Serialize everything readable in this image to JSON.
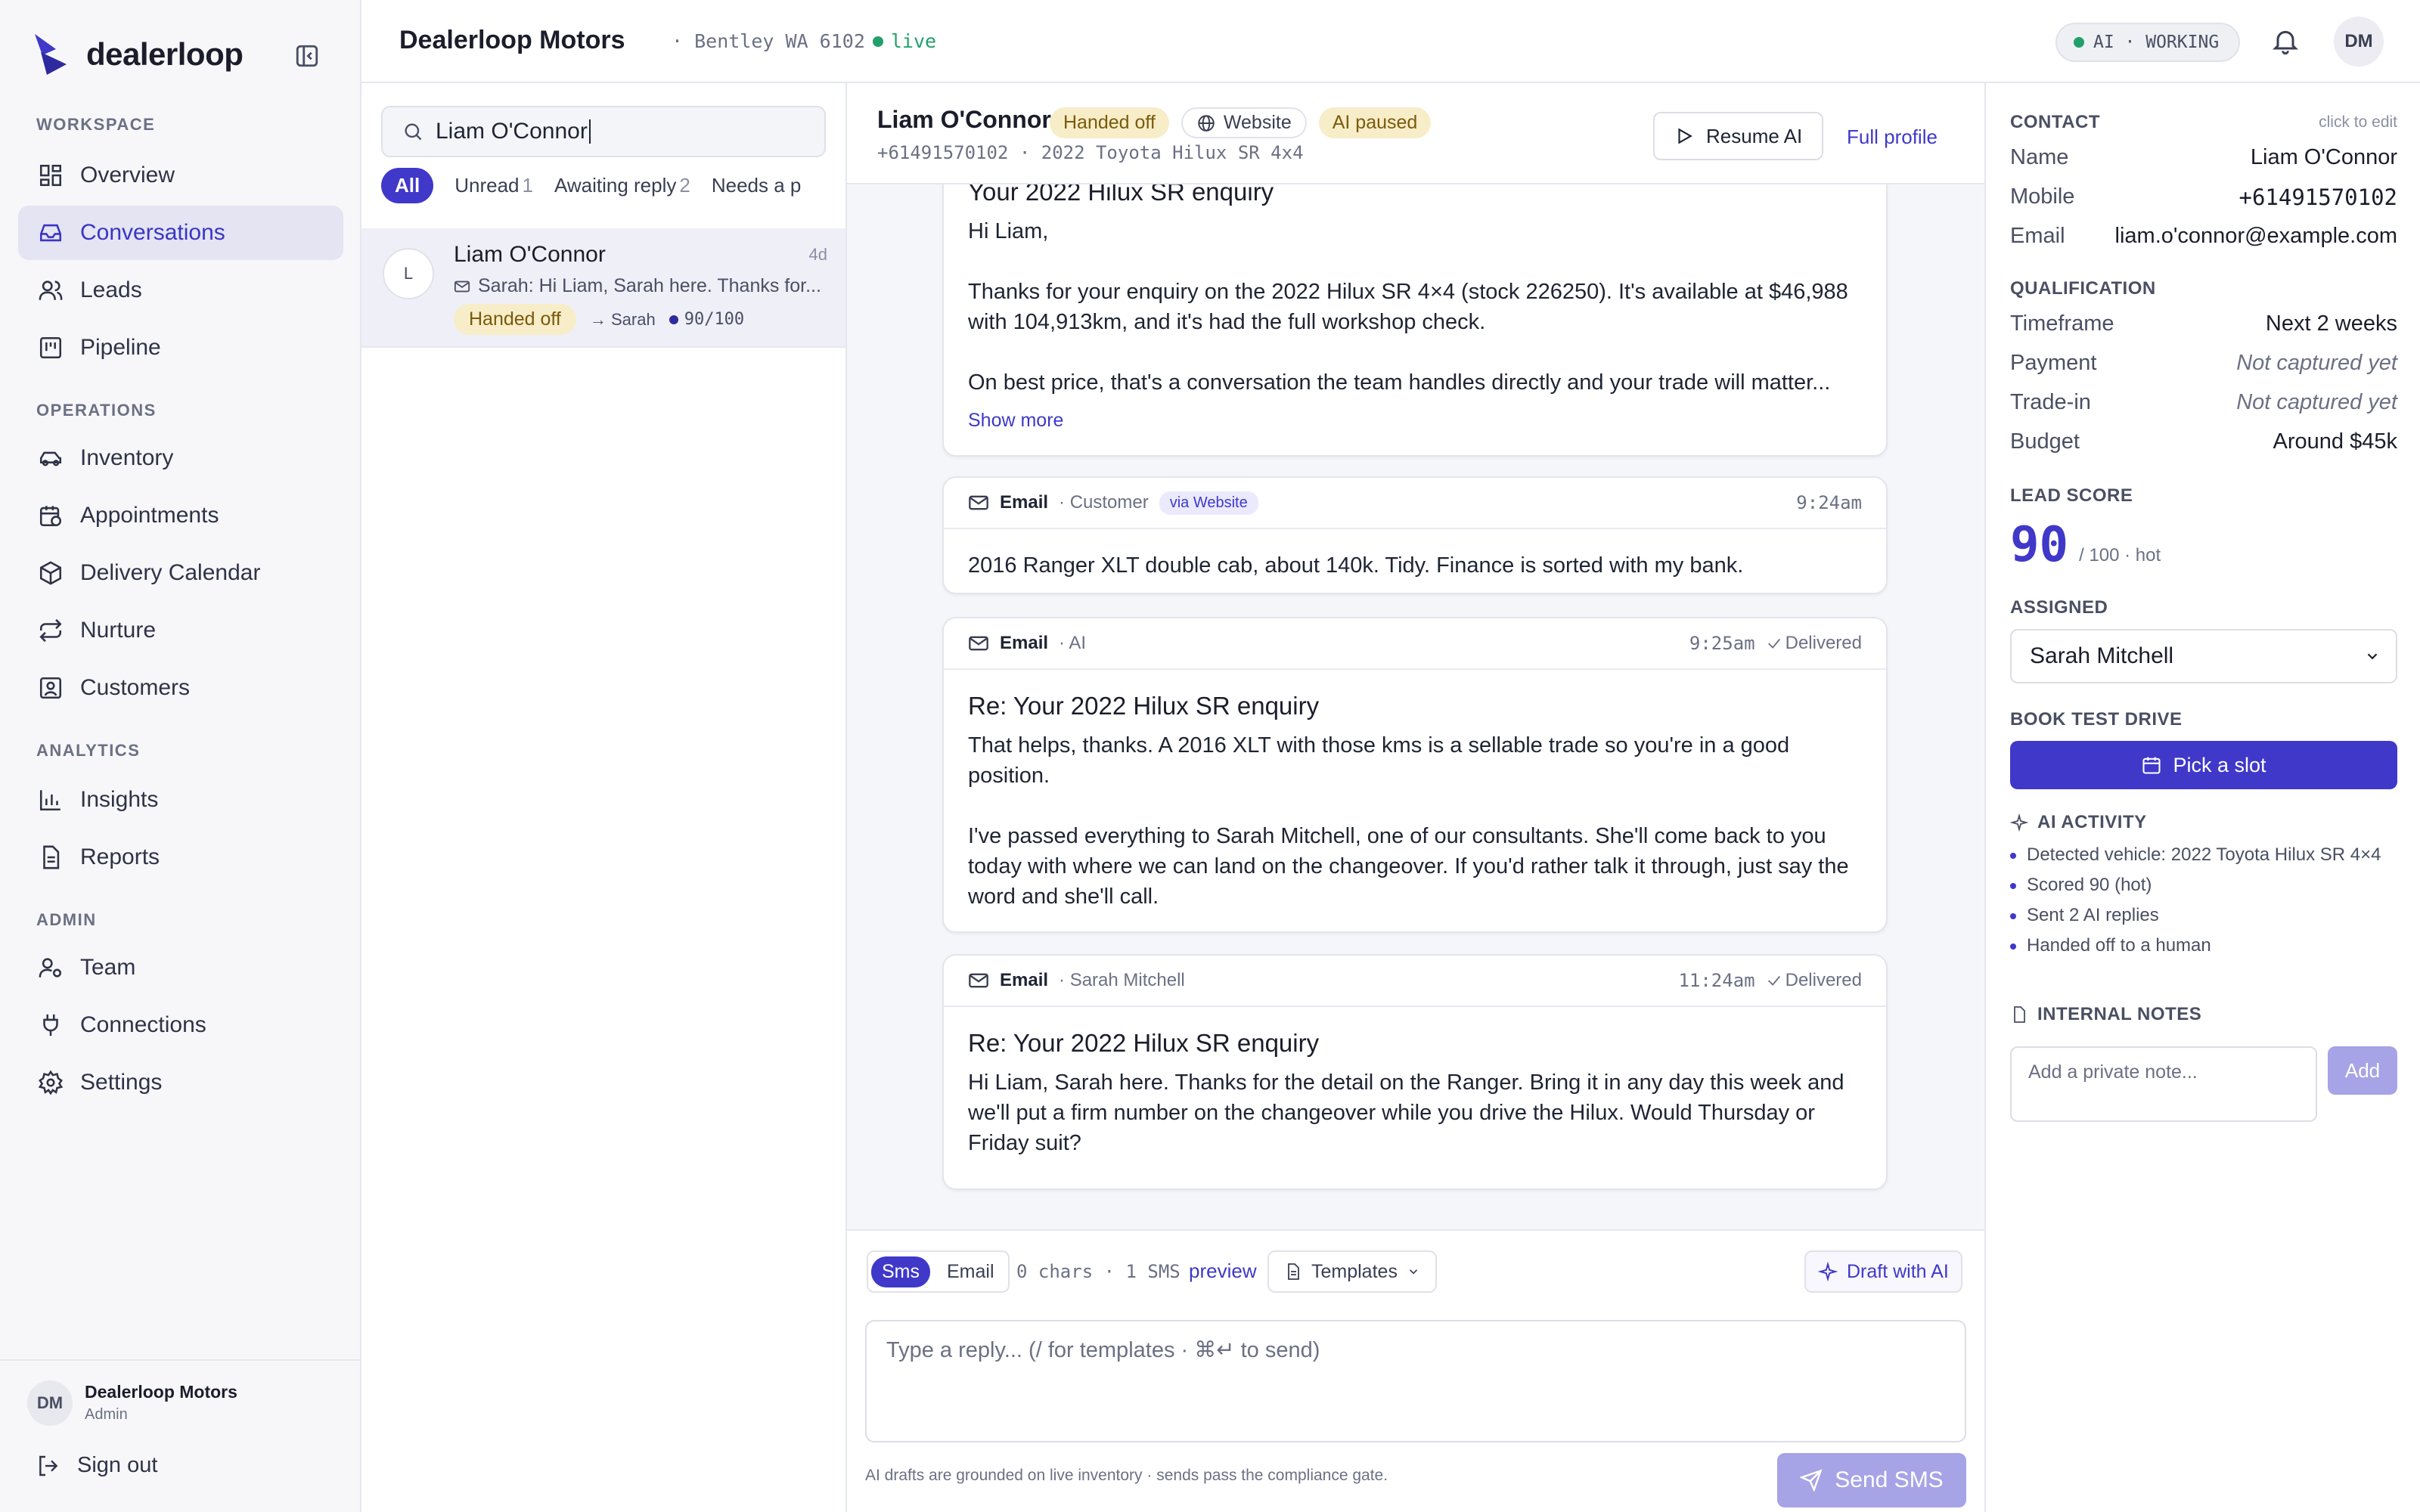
{
  "brand": {
    "name": "dealerloop"
  },
  "sidebar": {
    "sections": {
      "workspace": "WORKSPACE",
      "operations": "OPERATIONS",
      "analytics": "ANALYTICS",
      "admin": "ADMIN"
    },
    "items": [
      {
        "label": "Overview",
        "icon": "grid-icon"
      },
      {
        "label": "Conversations",
        "icon": "inbox-icon",
        "active": true
      },
      {
        "label": "Leads",
        "icon": "users-icon"
      },
      {
        "label": "Pipeline",
        "icon": "kanban-icon"
      },
      {
        "label": "Inventory",
        "icon": "car-icon"
      },
      {
        "label": "Appointments",
        "icon": "calendar-clock-icon"
      },
      {
        "label": "Delivery Calendar",
        "icon": "package-icon"
      },
      {
        "label": "Nurture",
        "icon": "repeat-icon"
      },
      {
        "label": "Customers",
        "icon": "contact-icon"
      },
      {
        "label": "Insights",
        "icon": "bar-chart-icon"
      },
      {
        "label": "Reports",
        "icon": "file-text-icon"
      },
      {
        "label": "Team",
        "icon": "user-cog-icon"
      },
      {
        "label": "Connections",
        "icon": "plug-icon"
      },
      {
        "label": "Settings",
        "icon": "gear-icon"
      }
    ],
    "footer": {
      "avatar": "DM",
      "org": "Dealerloop Motors",
      "role": "Admin",
      "signout": "Sign out"
    }
  },
  "topbar": {
    "org": "Dealerloop Motors",
    "location": "· Bentley WA 6102",
    "status": "live",
    "ai_status": "AI · WORKING",
    "avatar": "DM"
  },
  "list": {
    "search_value": "Liam O'Connor",
    "filters": [
      {
        "label": "All",
        "count": ""
      },
      {
        "label": "Unread",
        "count": "1"
      },
      {
        "label": "Awaiting reply",
        "count": "2"
      },
      {
        "label": "Needs a p",
        "count": ""
      }
    ],
    "conversation": {
      "initial": "L",
      "name": "Liam O'Connor",
      "age": "4d",
      "preview": "Sarah: Hi Liam, Sarah here. Thanks for...",
      "badge": "Handed off",
      "assignee": "→ Sarah",
      "score": "90/100"
    }
  },
  "thread": {
    "name": "Liam O'Connor",
    "badges": {
      "status": "Handed off",
      "source": "Website",
      "ai": "AI paused"
    },
    "subtitle": "+61491570102 · 2022 Toyota Hilux SR 4x4",
    "resume": "Resume AI",
    "full_profile": "Full profile",
    "messages": [
      {
        "subject": "Your 2022 Hilux SR enquiry",
        "greeting": "Hi Liam,",
        "p1": "Thanks for your enquiry on the 2022 Hilux SR 4×4 (stock 226250). It's available at $46,988 with 104,913km, and it's had the full workshop check.",
        "p2": "On best price, that's a conversation the team handles directly and your trade will matter...",
        "show_more": "Show more"
      },
      {
        "channel": "Email",
        "sender": "· Customer",
        "via": "via Website",
        "time": "9:24am",
        "body": "2016 Ranger XLT double cab, about 140k. Tidy. Finance is sorted with my bank."
      },
      {
        "channel": "Email",
        "sender": "· AI",
        "time": "9:25am",
        "status": "Delivered",
        "subject": "Re: Your 2022 Hilux SR enquiry",
        "p1": "That helps, thanks. A 2016 XLT with those kms is a sellable trade so you're in a good position.",
        "p2": "I've passed everything to Sarah Mitchell, one of our consultants. She'll come back to you today with where we can land on the changeover. If you'd rather talk it through, just say the word and she'll call."
      },
      {
        "channel": "Email",
        "sender": "· Sarah Mitchell",
        "time": "11:24am",
        "status": "Delivered",
        "subject": "Re: Your 2022 Hilux SR enquiry",
        "p1": "Hi Liam, Sarah here. Thanks for the detail on the Ranger. Bring it in any day this week and we'll put a firm number on the changeover while you drive the Hilux. Would Thursday or Friday suit?"
      }
    ]
  },
  "composer": {
    "mode_sms": "Sms",
    "mode_email": "Email",
    "count": "0 chars · 1 SMS",
    "preview": "preview",
    "templates": "Templates",
    "draft": "Draft with AI",
    "placeholder": "Type a reply... (/ for templates · ⌘↵ to send)",
    "note": "AI drafts are grounded on live inventory · sends pass the compliance gate.",
    "send": "Send SMS"
  },
  "contact": {
    "title": "CONTACT",
    "edit": "click to edit",
    "name_k": "Name",
    "name_v": "Liam O'Connor",
    "mobile_k": "Mobile",
    "mobile_v": "+61491570102",
    "email_k": "Email",
    "email_v": "liam.o'connor@example.com",
    "qual_title": "QUALIFICATION",
    "timeframe_k": "Timeframe",
    "timeframe_v": "Next 2 weeks",
    "payment_k": "Payment",
    "payment_v": "Not captured yet",
    "tradein_k": "Trade-in",
    "tradein_v": "Not captured yet",
    "budget_k": "Budget",
    "budget_v": "Around $45k",
    "score_title": "LEAD SCORE",
    "score": "90",
    "score_suffix": "/ 100 · hot",
    "assigned_title": "ASSIGNED",
    "assigned": "Sarah Mitchell",
    "test_drive_title": "BOOK TEST DRIVE",
    "pick_slot": "Pick a slot",
    "activity_title": "AI ACTIVITY",
    "activity": [
      "Detected vehicle: 2022 Toyota Hilux SR 4×4",
      "Scored 90 (hot)",
      "Sent 2 AI replies",
      "Handed off to a human"
    ],
    "notes_title": "INTERNAL NOTES",
    "notes_placeholder": "Add a private note...",
    "notes_add": "Add"
  },
  "colors": {
    "accent": "#3f38c9",
    "live": "#22a06b",
    "warn_bg": "#f7edc8"
  }
}
